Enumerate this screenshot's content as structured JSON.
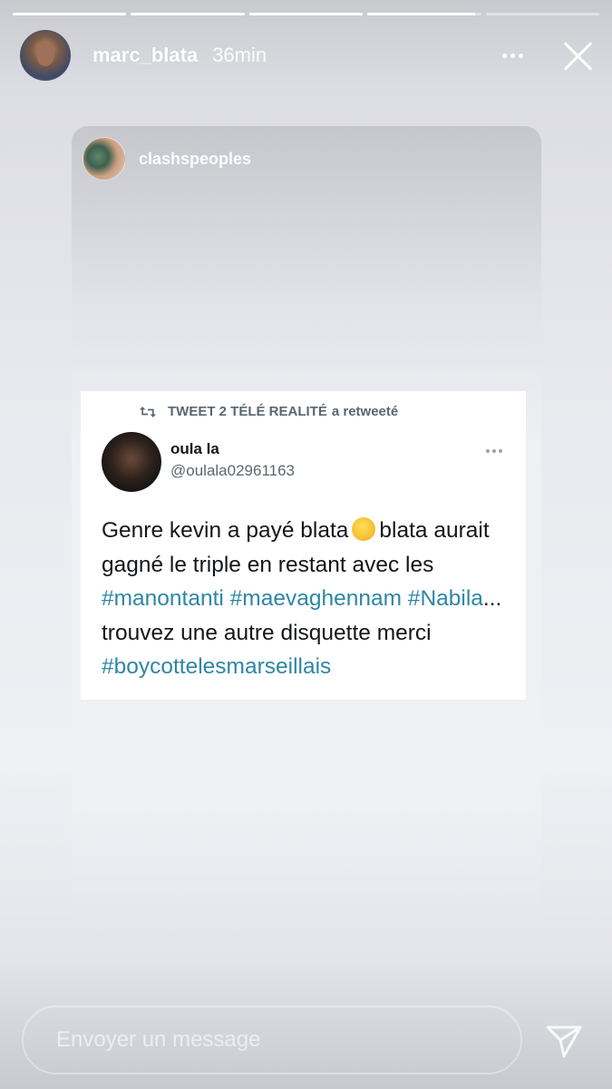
{
  "story": {
    "segments": [
      1,
      1,
      1,
      1,
      0
    ],
    "username": "marc_blata",
    "time": "36min",
    "shared": {
      "username": "clashspeoples"
    },
    "tweet": {
      "retweet_by": "TWEET 2 TÉLÉ REALITÉ",
      "retweet_suffix": "a retweeté",
      "author_name": "oula la",
      "author_handle": "@oulala02961163",
      "text_parts": {
        "p1": "Genre kevin a payé blata",
        "emoji_name": "rofl-emoji",
        "p2": "blata aurait gagné le triple en restant avec les",
        "tag1": "#manontanti",
        "tag2": "#maevaghennam",
        "tag3": "#Nabila",
        "p3": "... trouvez une autre disquette merci",
        "tag4": "#boycottelesmarseillais"
      }
    },
    "reply": {
      "placeholder": "Envoyer un message"
    },
    "icons": {
      "more": "more-horizontal-icon",
      "close": "close-icon",
      "retweet": "retweet-icon",
      "send": "send-icon"
    },
    "colors": {
      "hashtag": "#2e86a6",
      "handle": "#5b6770"
    }
  }
}
